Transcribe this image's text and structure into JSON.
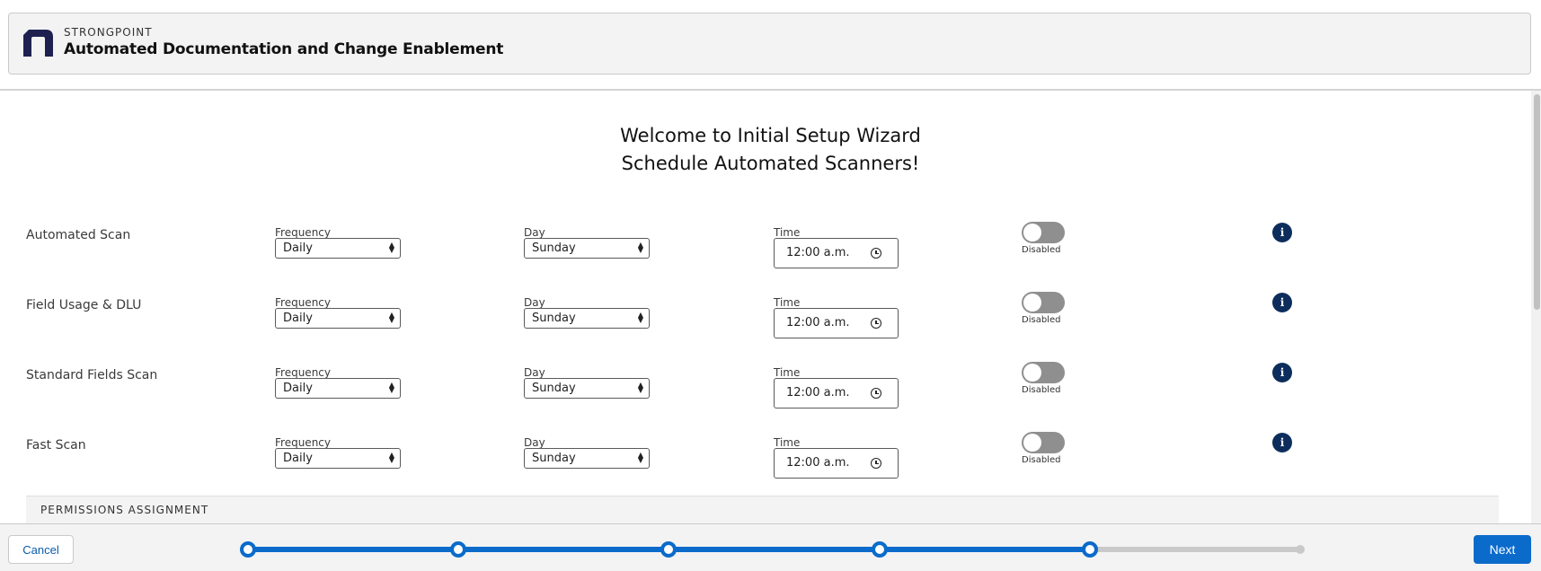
{
  "header": {
    "brand": "STRONGPOINT",
    "title": "Automated Documentation and Change Enablement"
  },
  "welcome": {
    "line1": "Welcome to Initial Setup Wizard",
    "line2": "Schedule Automated Scanners!"
  },
  "labels": {
    "frequency": "Frequency",
    "day": "Day",
    "time": "Time"
  },
  "scanners": [
    {
      "name": "Automated Scan",
      "frequency": "Daily",
      "day": "Sunday",
      "time": "12:00 a.m.",
      "status": "Disabled"
    },
    {
      "name": "Field Usage & DLU",
      "frequency": "Daily",
      "day": "Sunday",
      "time": "12:00 a.m.",
      "status": "Disabled"
    },
    {
      "name": "Standard Fields Scan",
      "frequency": "Daily",
      "day": "Sunday",
      "time": "12:00 a.m.",
      "status": "Disabled"
    },
    {
      "name": "Fast Scan",
      "frequency": "Daily",
      "day": "Sunday",
      "time": "12:00 a.m.",
      "status": "Disabled"
    }
  ],
  "permissions": {
    "title": "PERMISSIONS ASSIGNMENT"
  },
  "footer": {
    "cancel_label": "Cancel",
    "next_label": "Next"
  },
  "progress": {
    "total_steps": 6,
    "completed_steps": 5
  },
  "colors": {
    "accent": "#0b6bcb",
    "info_icon": "#0d2e5c",
    "toggle_off": "#8f8f8f"
  },
  "icons": {
    "info": "info-icon",
    "clock": "clock-icon",
    "select": "select-arrows-icon",
    "logo": "strongpoint-logo-icon"
  }
}
